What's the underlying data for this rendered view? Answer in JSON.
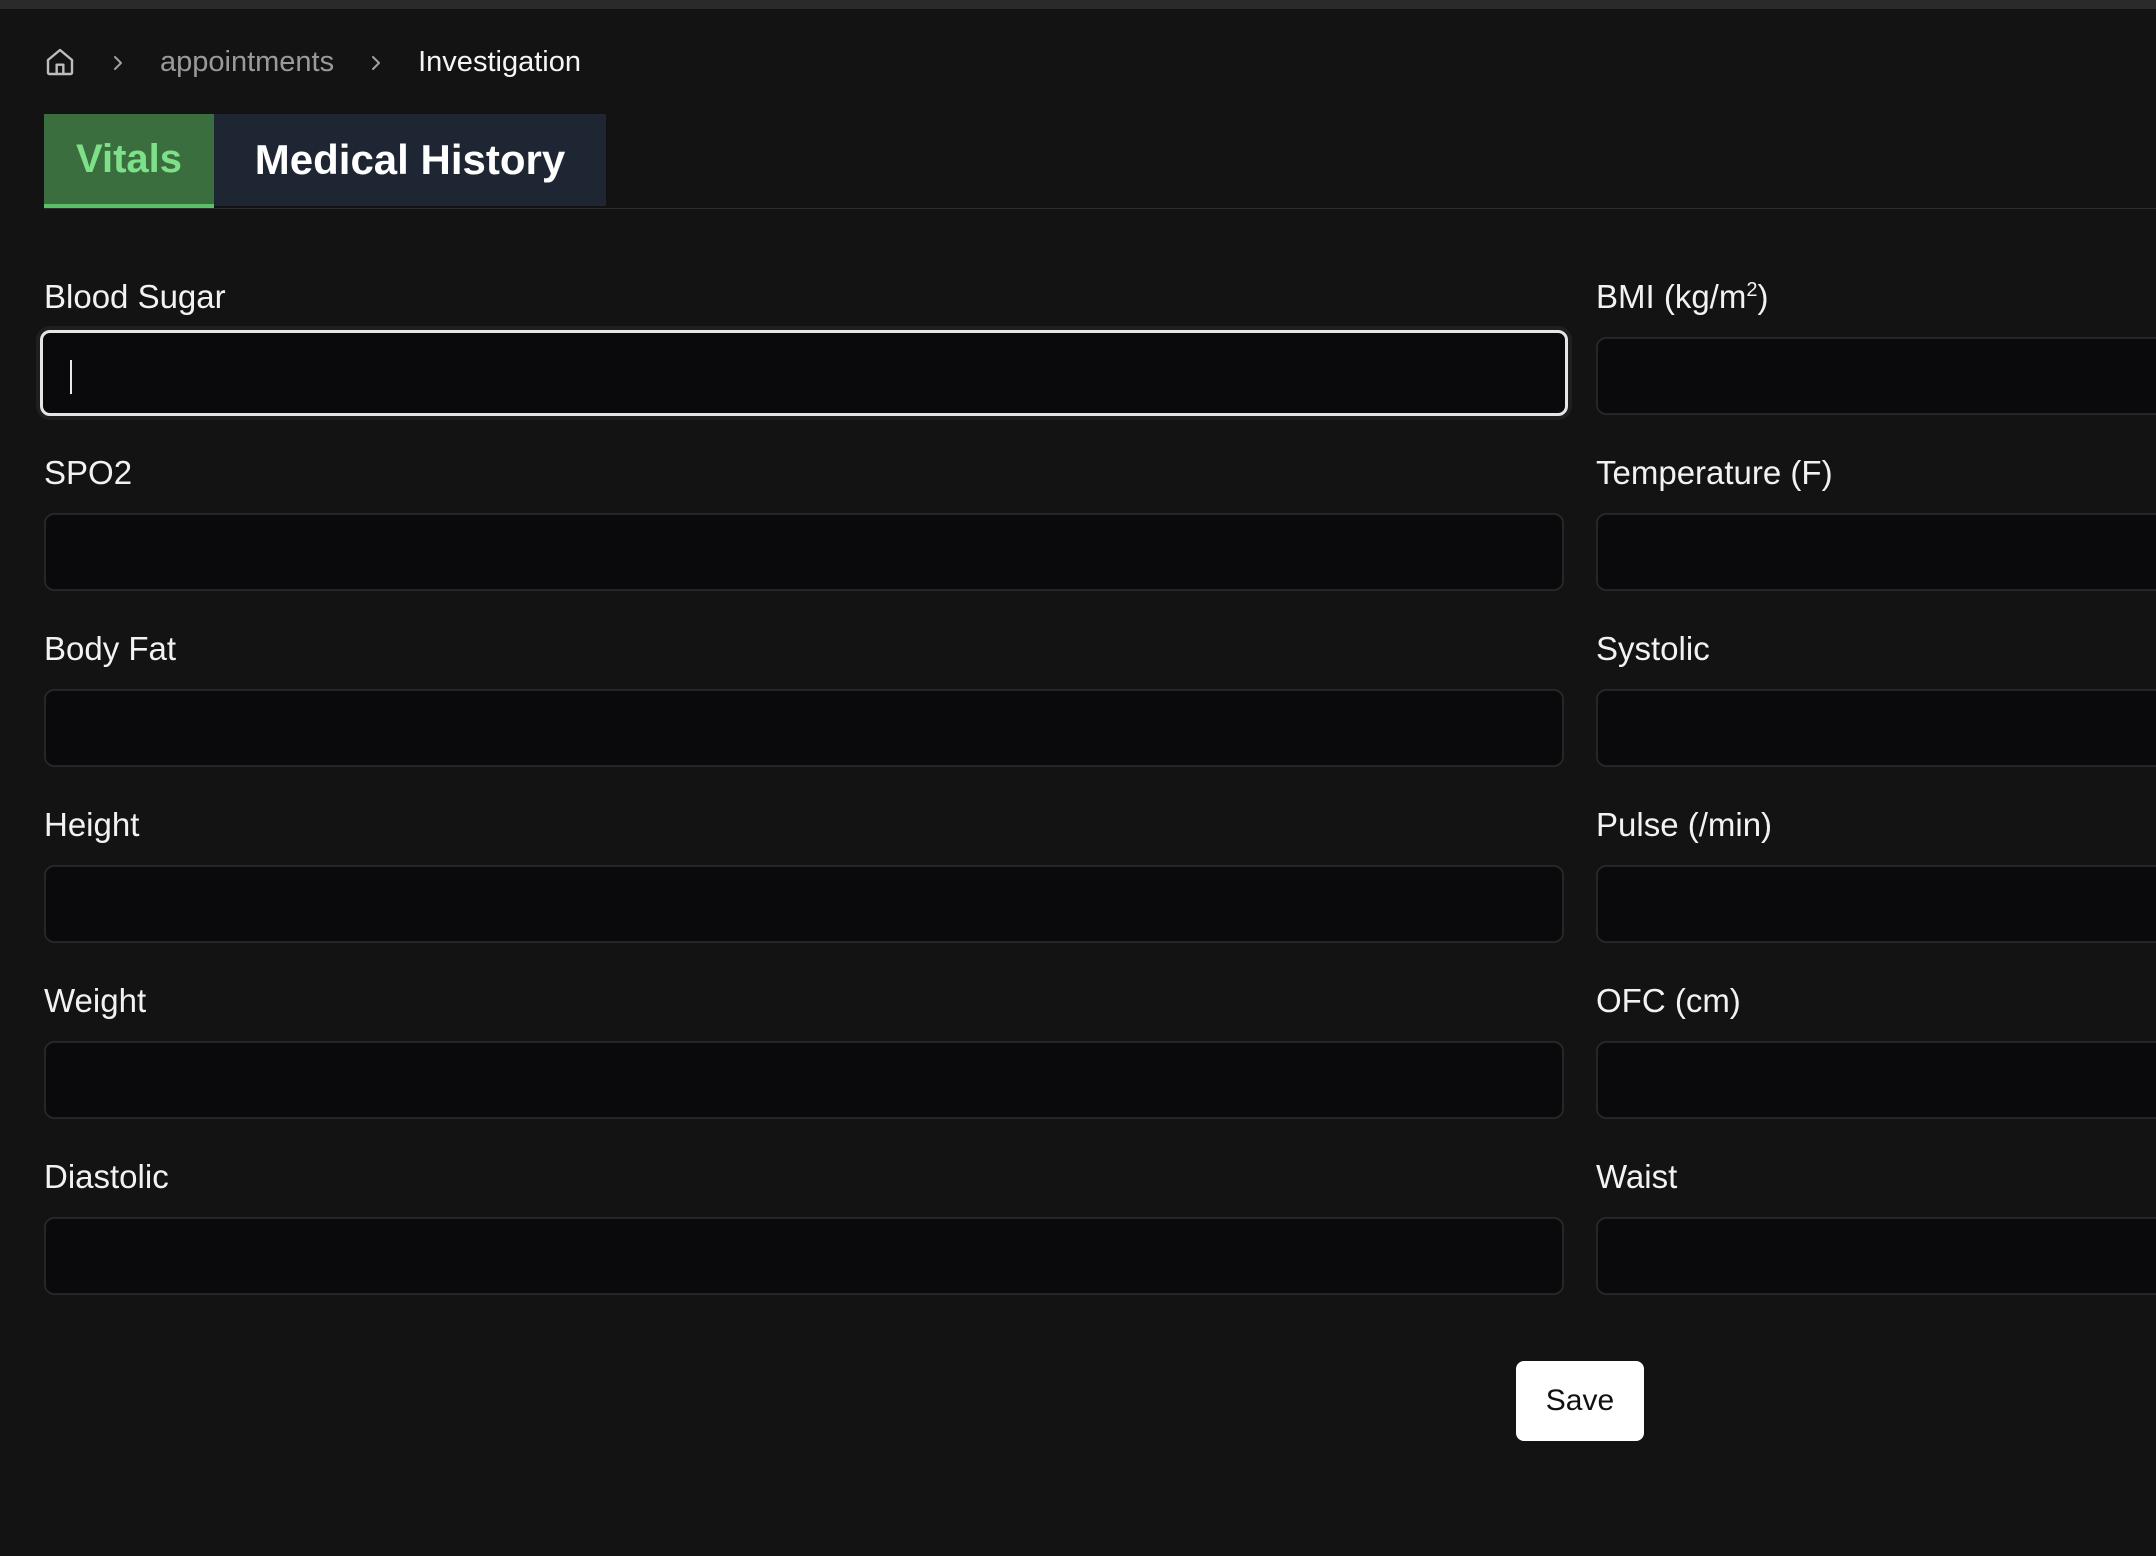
{
  "breadcrumb": {
    "home_icon": "home-icon",
    "separator_icon": "chevron-right-icon",
    "items": [
      "appointments",
      "Investigation"
    ]
  },
  "tabs": [
    {
      "label": "Vitals",
      "active": true
    },
    {
      "label": "Medical History",
      "active": false
    }
  ],
  "fields": {
    "left": [
      {
        "label": "Blood Sugar",
        "value": "",
        "focused": true
      },
      {
        "label": "SPO2",
        "value": ""
      },
      {
        "label": "Body Fat",
        "value": ""
      },
      {
        "label": "Height",
        "value": ""
      },
      {
        "label": "Weight",
        "value": ""
      },
      {
        "label": "Diastolic",
        "value": ""
      }
    ],
    "right": [
      {
        "label_main": "BMI (kg/m",
        "label_sup": "2",
        "label_end": ")",
        "value": ""
      },
      {
        "label": "Temperature (F)",
        "value": ""
      },
      {
        "label": "Systolic",
        "value": ""
      },
      {
        "label": "Pulse (/min)",
        "value": ""
      },
      {
        "label": "OFC (cm)",
        "value": ""
      },
      {
        "label": "Waist",
        "value": ""
      }
    ]
  },
  "actions": {
    "save_label": "Save"
  },
  "colors": {
    "background": "#131313",
    "active_tab_bg": "#3b6e3e",
    "active_tab_text": "#7fe08a",
    "inactive_tab_bg": "#1f2633"
  }
}
